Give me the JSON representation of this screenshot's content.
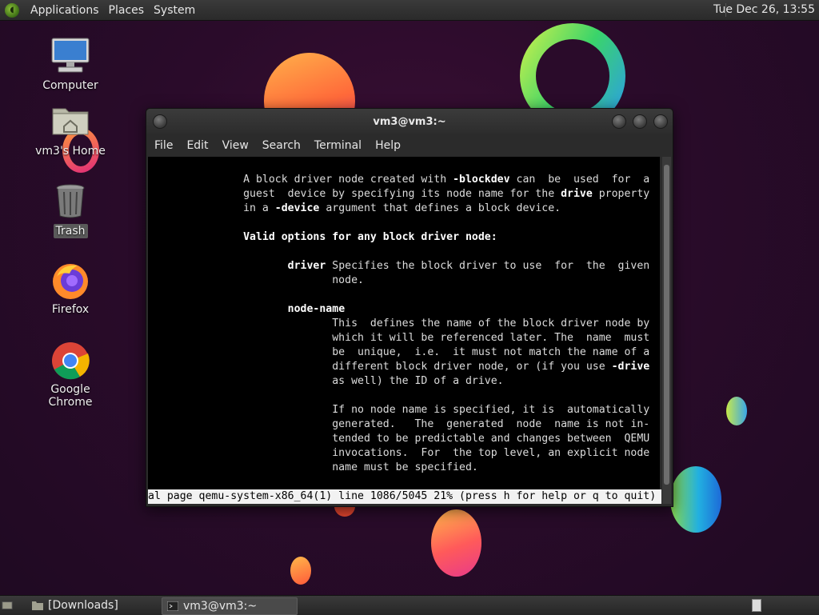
{
  "top_panel": {
    "menus": [
      "Applications",
      "Places",
      "System"
    ],
    "clock": "Tue Dec 26, 13:55"
  },
  "desktop_icons": [
    {
      "label": "Computer",
      "icon": "computer-icon"
    },
    {
      "label": "vm3's Home",
      "icon": "home-folder-icon"
    },
    {
      "label": "Trash",
      "icon": "trash-icon"
    },
    {
      "label": "Firefox",
      "icon": "firefox-icon"
    },
    {
      "label": "Google Chrome",
      "icon": "chrome-icon"
    }
  ],
  "terminal": {
    "title": "vm3@vm3:~",
    "menu": [
      "File",
      "Edit",
      "View",
      "Search",
      "Terminal",
      "Help"
    ],
    "lines": [
      [
        {
          "t": "               A block driver node created with "
        },
        {
          "t": "-blockdev",
          "b": true
        },
        {
          "t": " can  be  used  for  a"
        }
      ],
      [
        {
          "t": "               guest  device by specifying its node name for the "
        },
        {
          "t": "drive",
          "b": true
        },
        {
          "t": " property"
        }
      ],
      [
        {
          "t": "               in a "
        },
        {
          "t": "-device",
          "b": true
        },
        {
          "t": " argument that defines a block device."
        }
      ],
      [
        {
          "t": ""
        }
      ],
      [
        {
          "t": "               "
        },
        {
          "t": "Valid options for any block driver node:",
          "b": true
        }
      ],
      [
        {
          "t": ""
        }
      ],
      [
        {
          "t": "                      "
        },
        {
          "t": "driver",
          "b": true
        },
        {
          "t": " Specifies the block driver to use  for  the  given"
        }
      ],
      [
        {
          "t": "                             node."
        }
      ],
      [
        {
          "t": ""
        }
      ],
      [
        {
          "t": "                      "
        },
        {
          "t": "node-name",
          "b": true
        }
      ],
      [
        {
          "t": "                             This  defines the name of the block driver node by"
        }
      ],
      [
        {
          "t": "                             which it will be referenced later. The  name  must"
        }
      ],
      [
        {
          "t": "                             be  unique,  i.e.  it must not match the name of a"
        }
      ],
      [
        {
          "t": "                             different block driver node, or (if you use "
        },
        {
          "t": "-drive",
          "b": true
        }
      ],
      [
        {
          "t": "                             as well) the ID of a drive."
        }
      ],
      [
        {
          "t": ""
        }
      ],
      [
        {
          "t": "                             If no node name is specified, it is  automatically"
        }
      ],
      [
        {
          "t": "                             generated.   The  generated  node  name is not in-"
        }
      ],
      [
        {
          "t": "                             tended to be predictable and changes between  QEMU"
        }
      ],
      [
        {
          "t": "                             invocations.  For  the top level, an explicit node"
        }
      ],
      [
        {
          "t": "                             name must be specified."
        }
      ]
    ],
    "status_line": "al page qemu-system-x86_64(1) line 1086/5045 21% (press h for help or q to quit)"
  },
  "bottom_panel": {
    "tasks": [
      {
        "label": "[Downloads]",
        "icon": "folder-icon"
      },
      {
        "label": "vm3@vm3:~",
        "icon": "terminal-icon"
      }
    ]
  }
}
